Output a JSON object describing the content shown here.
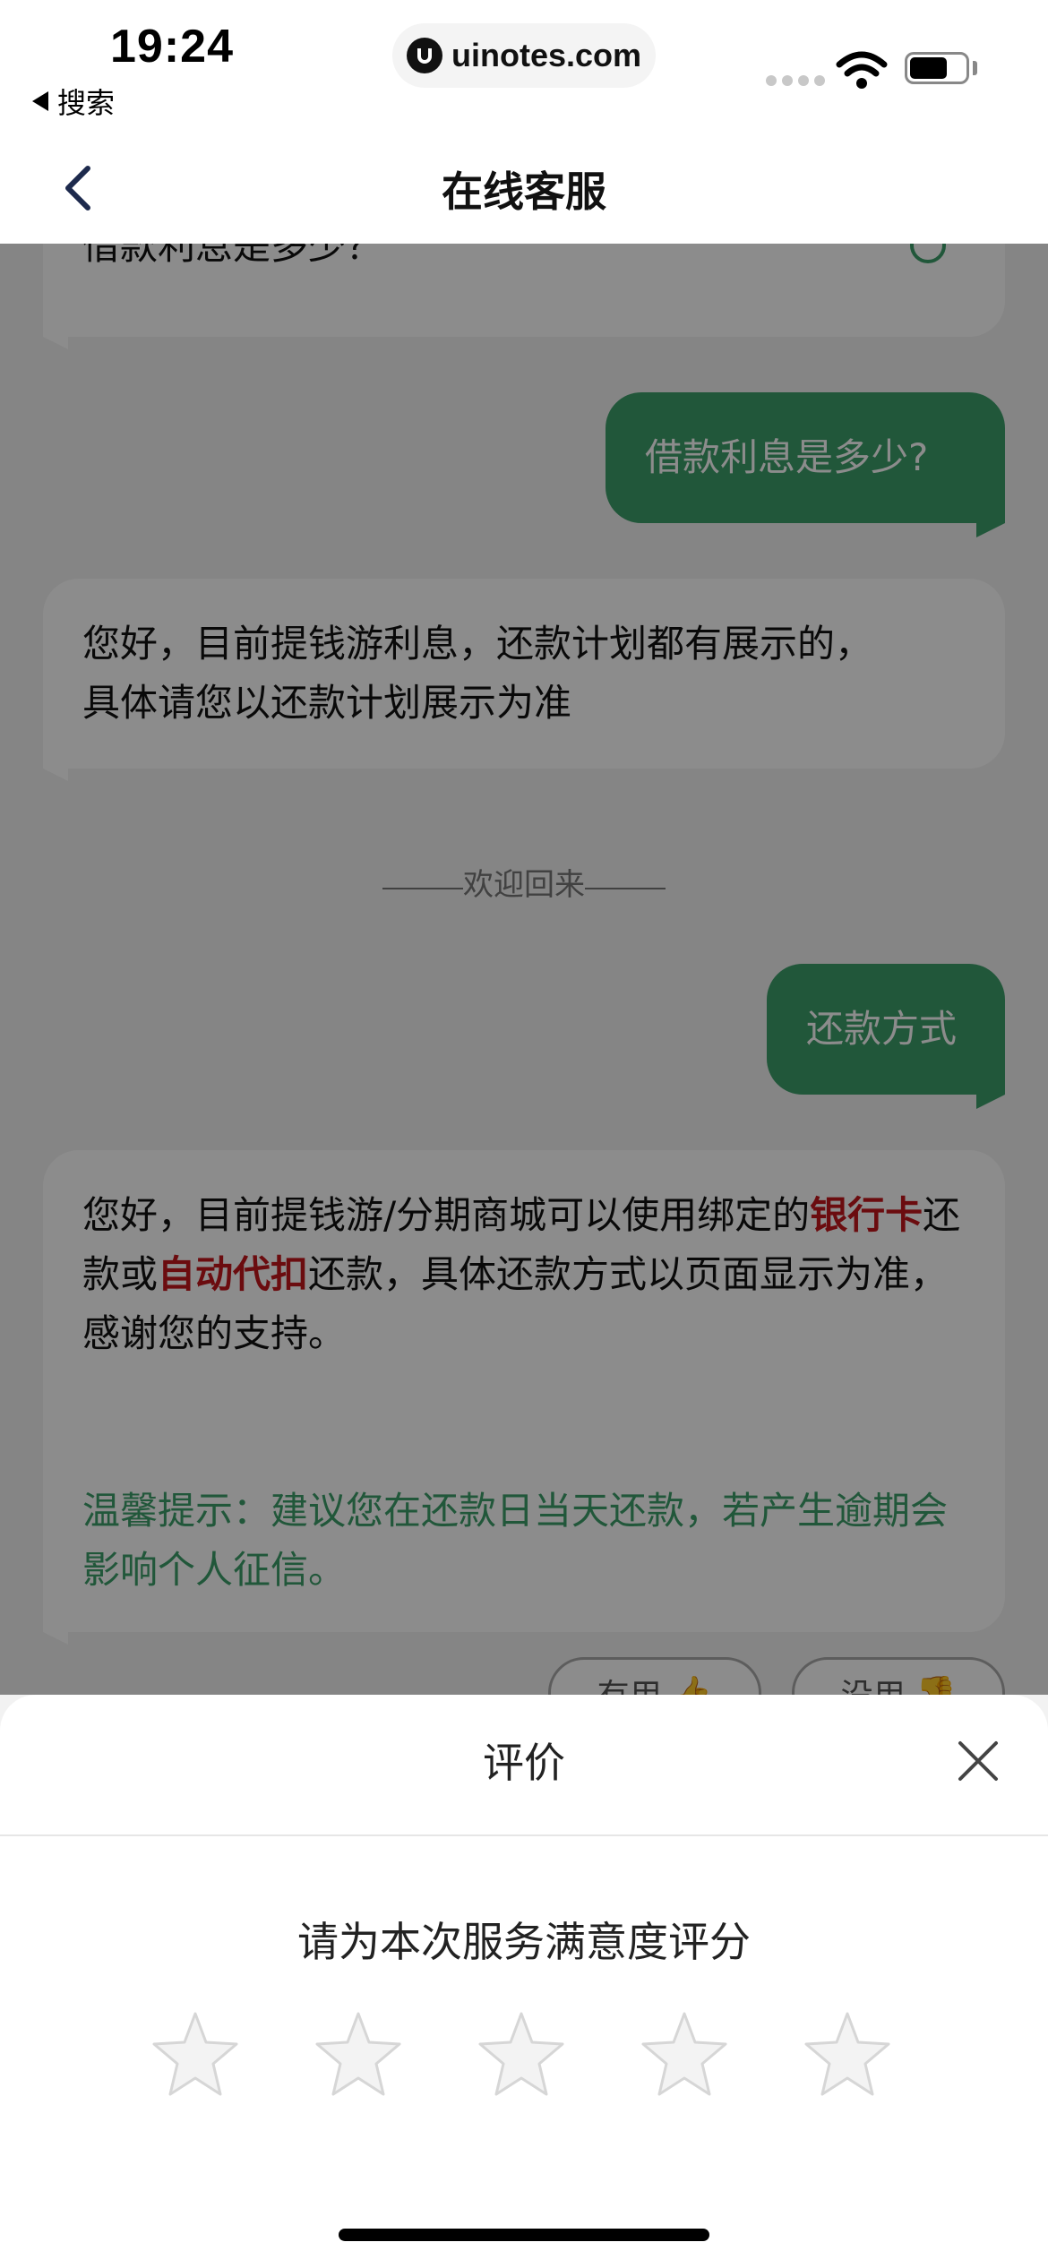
{
  "status_bar": {
    "time": "19:24",
    "back_app": "搜索",
    "url": "uinotes.com"
  },
  "nav": {
    "title": "在线客服"
  },
  "chat": {
    "partial_question": "借款利息是多少？",
    "user_q1": "借款利息是多少?",
    "bot_a1_line1": "您好，目前提钱游利息，还款计划都有展示的，",
    "bot_a1_line2": "具体请您以还款计划展示为准",
    "welcome": "欢迎回来",
    "user_q2": "还款方式",
    "bot_a2": {
      "p1": "您好，目前提钱游/分期商城可以使用绑定的",
      "red1": "银行卡",
      "p2": "还款或",
      "red2": "自动代扣",
      "p3": "还款，具体还款方式以页面显示为准，感谢您的支持。",
      "tip": "温馨提示：建议您在还款日当天还款，若产生逾期会影响个人征信。"
    },
    "useful_label": "有用",
    "useless_label": "没用"
  },
  "rating_sheet": {
    "title": "评价",
    "prompt": "请为本次服务满意度评分",
    "stars": 5,
    "selected": 0
  }
}
